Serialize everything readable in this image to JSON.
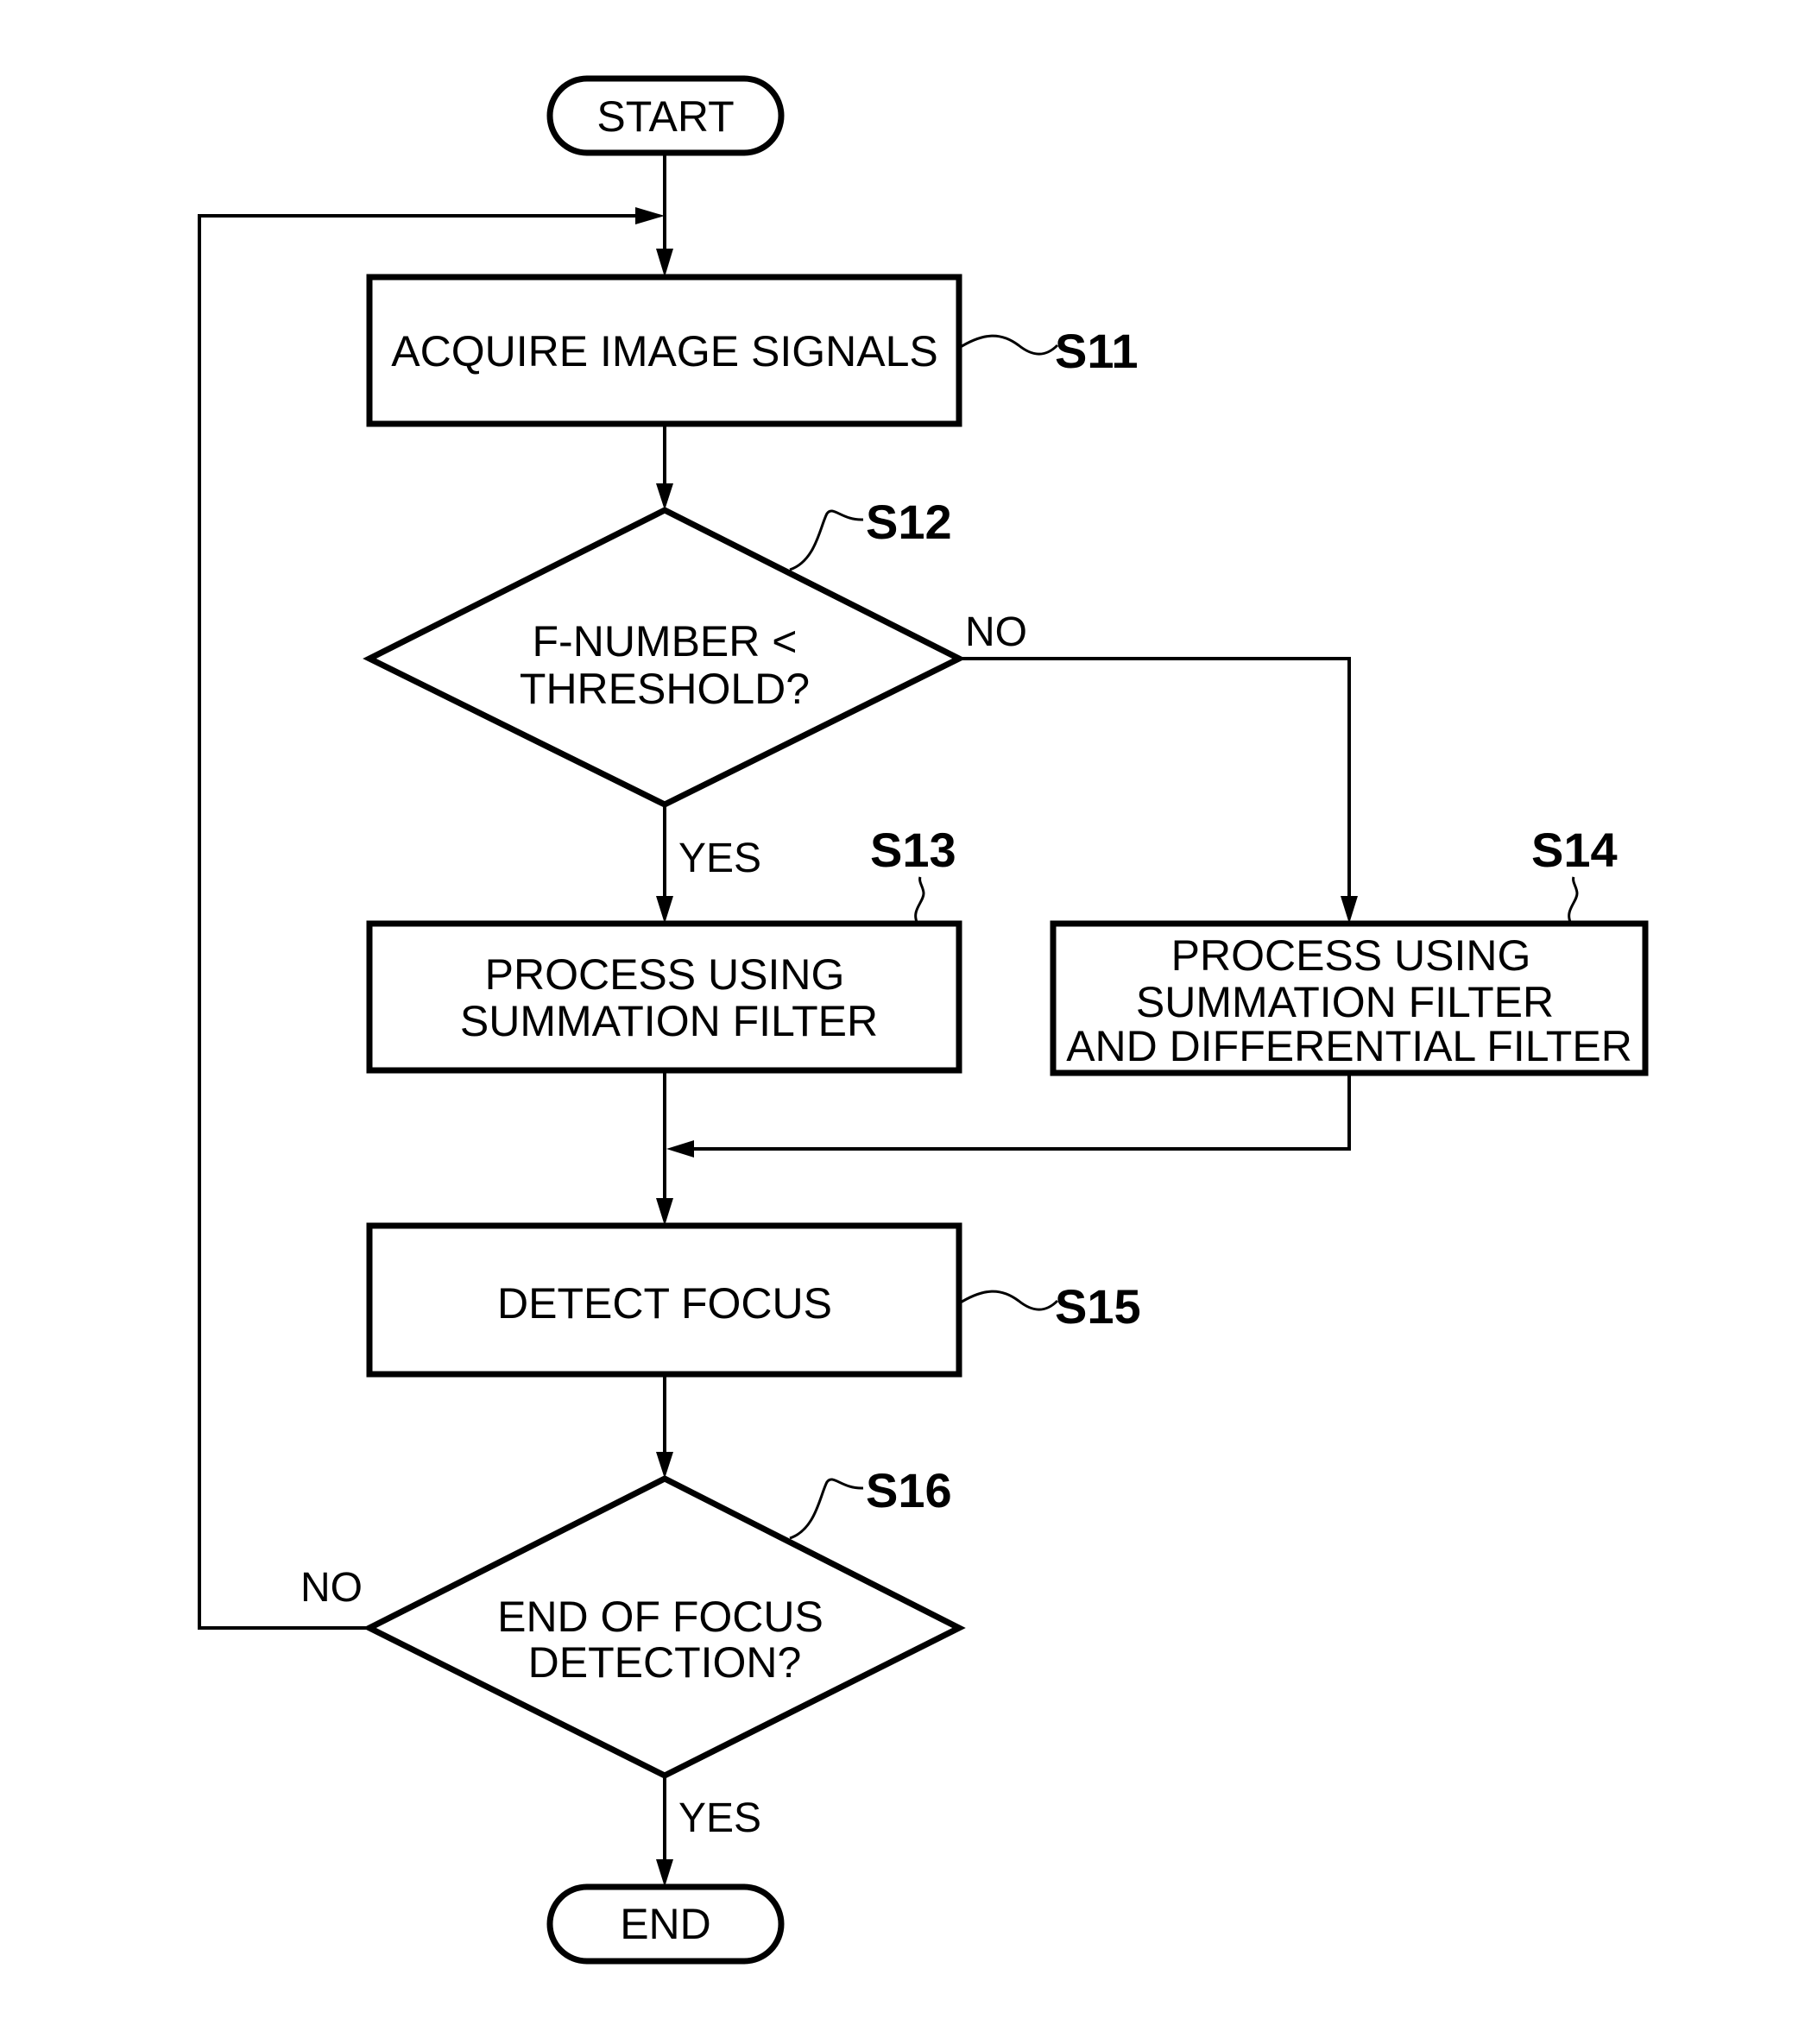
{
  "diagram": {
    "type": "flowchart",
    "colors": {
      "stroke": "#000000",
      "background": "#ffffff"
    },
    "terminals": {
      "start": "START",
      "end": "END"
    },
    "steps": {
      "s11": {
        "id": "S11",
        "lines": [
          "ACQUIRE IMAGE SIGNALS"
        ]
      },
      "s12": {
        "id": "S12",
        "lines": [
          "F-NUMBER <",
          "THRESHOLD?"
        ]
      },
      "s13": {
        "id": "S13",
        "lines": [
          "PROCESS USING",
          "SUMMATION FILTER"
        ]
      },
      "s14": {
        "id": "S14",
        "lines": [
          "PROCESS USING",
          "SUMMATION FILTER",
          "AND DIFFERENTIAL FILTER"
        ]
      },
      "s15": {
        "id": "S15",
        "lines": [
          "DETECT FOCUS"
        ]
      },
      "s16": {
        "id": "S16",
        "lines": [
          "END OF FOCUS",
          "DETECTION?"
        ]
      }
    },
    "branches": {
      "s12_no": "NO",
      "s12_yes": "YES",
      "s16_no": "NO",
      "s16_yes": "YES"
    }
  }
}
